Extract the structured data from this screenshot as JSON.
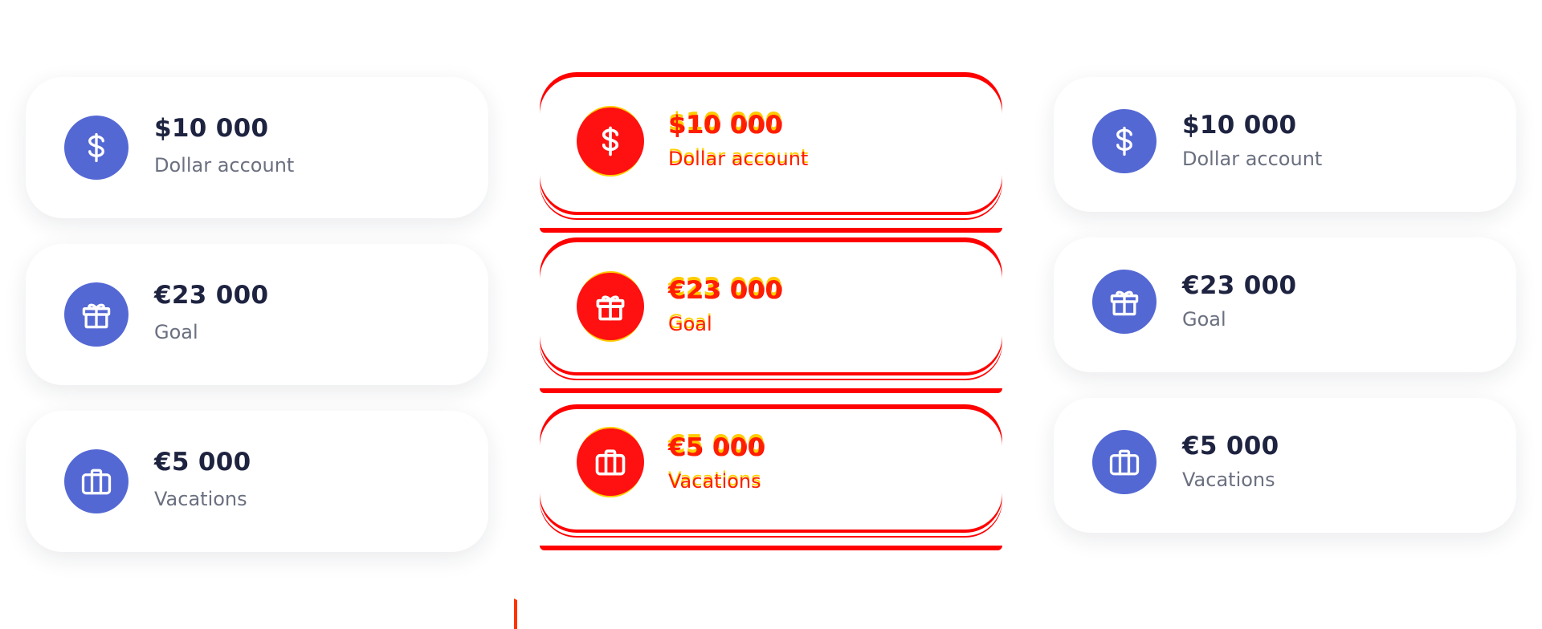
{
  "accounts": [
    {
      "amount": "$10 000",
      "label": "Dollar account",
      "icon": "dollar-icon"
    },
    {
      "amount": "€23 000",
      "label": "Goal",
      "icon": "gift-icon"
    },
    {
      "amount": "€5 000",
      "label": "Vacations",
      "icon": "briefcase-icon"
    }
  ],
  "colors": {
    "accent": "#5468d4",
    "amount_text": "#1e2340",
    "label_text": "#6b7080",
    "glitch_red": "#ff0000",
    "glitch_yellow": "#ffcc00"
  }
}
